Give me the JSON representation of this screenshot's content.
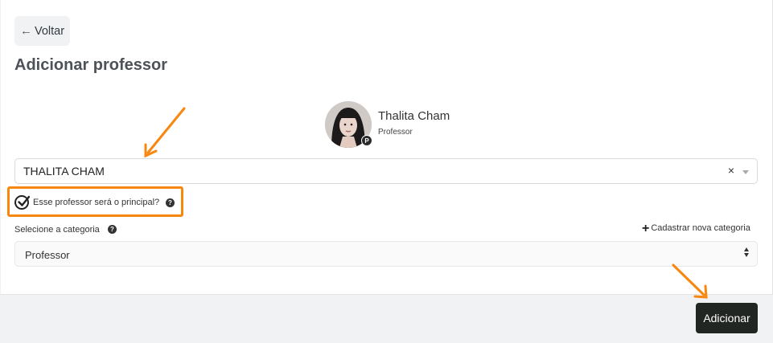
{
  "header": {
    "back_label": "Voltar",
    "title": "Adicionar professor"
  },
  "profile": {
    "name": "Thalita Cham",
    "role": "Professor",
    "badge": "P"
  },
  "teacher_select": {
    "value": "THALITA CHAM",
    "clear_icon": "×"
  },
  "principal": {
    "label": "Esse professor será o principal?",
    "checked": true,
    "help_icon": "?"
  },
  "category": {
    "label": "Selecione a categoria",
    "help_icon": "?",
    "new_label": "Cadastrar nova categoria",
    "value": "Professor"
  },
  "footer": {
    "add_label": "Adicionar"
  },
  "colors": {
    "highlight": "#f7870e",
    "primary_button": "#222623"
  }
}
